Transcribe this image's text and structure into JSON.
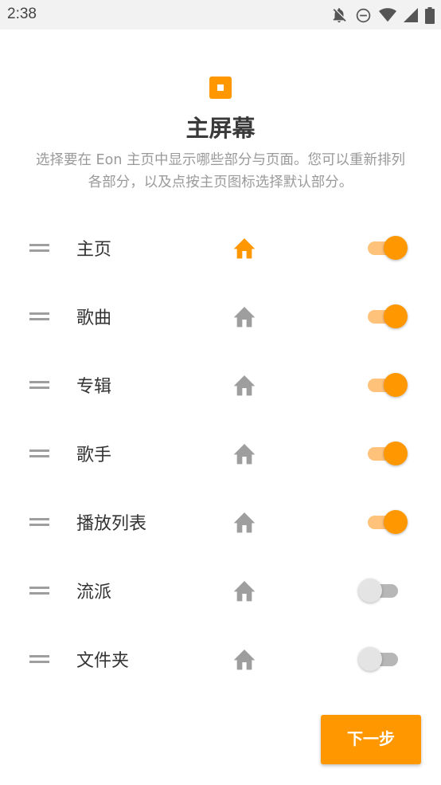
{
  "status_bar": {
    "time": "2:38",
    "icons": [
      "notifications-off-icon",
      "do-not-disturb-icon",
      "wifi-icon",
      "cellular-signal-icon",
      "battery-icon"
    ]
  },
  "header": {
    "logo_icon": "eon-logo-icon",
    "title": "主屏幕",
    "description": "选择要在 Eon 主页中显示哪些部分与页面。您可以重新排列各部分，以及点按主页图标选择默认部分。"
  },
  "sections": [
    {
      "label": "主页",
      "is_default": true,
      "enabled": true
    },
    {
      "label": "歌曲",
      "is_default": false,
      "enabled": true
    },
    {
      "label": "专辑",
      "is_default": false,
      "enabled": true
    },
    {
      "label": "歌手",
      "is_default": false,
      "enabled": true
    },
    {
      "label": "播放列表",
      "is_default": false,
      "enabled": true
    },
    {
      "label": "流派",
      "is_default": false,
      "enabled": false
    },
    {
      "label": "文件夹",
      "is_default": false,
      "enabled": false
    }
  ],
  "footer": {
    "next_label": "下一步"
  },
  "colors": {
    "accent": "#ff9800",
    "accent_light": "#ffc27a",
    "home_inactive": "#9e9e9e",
    "switch_off_thumb": "#e4e4e4",
    "switch_off_track": "#b7b7b7"
  }
}
